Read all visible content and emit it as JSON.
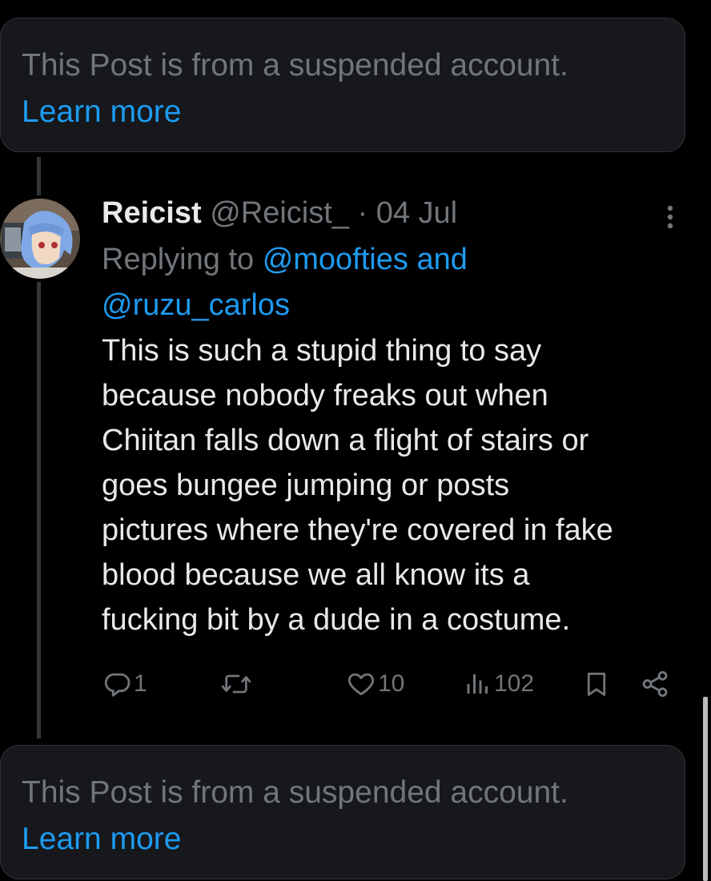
{
  "notices": [
    {
      "text": "This Post is from a suspended account.",
      "link": "Learn more"
    },
    {
      "text": "This Post is from a suspended account.",
      "link": "Learn more"
    }
  ],
  "post": {
    "author_name": "Reicist",
    "author_handle": "@Reicist_",
    "separator": "·",
    "date": "04 Jul",
    "replying_prefix": "Replying to",
    "mention_1": "@moofties",
    "replying_conjunction": "and",
    "mention_2": "@ruzu_carlos",
    "text": "This is such a stupid thing to say\nbecause nobody freaks out when\nChiitan falls down a flight of stairs or\ngoes bungee jumping or posts\npictures where they're covered in fake\nblood because we all know its a\nfucking bit by a dude in a costume.",
    "stats": {
      "replies": "1",
      "reposts": "",
      "likes": "10",
      "views": "102"
    }
  },
  "colors": {
    "background": "#000000",
    "card": "#16181c",
    "text_primary": "#e7e9ea",
    "text_secondary": "#71767b",
    "accent": "#1d9bf0"
  },
  "icons": {
    "reply": "reply-icon",
    "repost": "repost-icon",
    "like": "heart-icon",
    "views": "views-chart-icon",
    "bookmark": "bookmark-icon",
    "share": "share-icon",
    "more": "more-vertical-icon"
  }
}
